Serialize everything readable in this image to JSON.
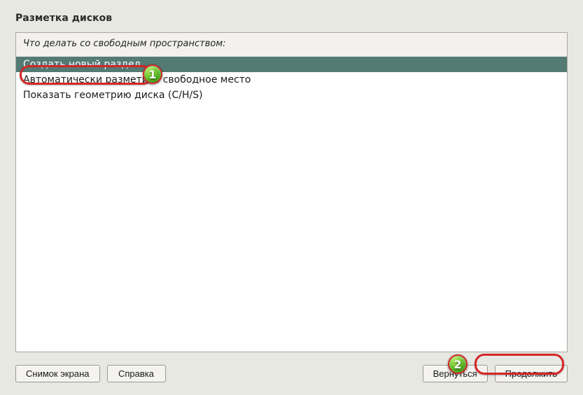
{
  "window": {
    "title": "Разметка дисков"
  },
  "prompt": "Что делать со свободным пространством:",
  "options": [
    {
      "label": "Создать новый раздел",
      "selected": true
    },
    {
      "label": "Автоматически разметить свободное место",
      "selected": false
    },
    {
      "label": "Показать геометрию диска (C/H/S)",
      "selected": false
    }
  ],
  "buttons": {
    "screenshot": "Снимок экрана",
    "help": "Справка",
    "back": "Вернуться",
    "continue": "Продолжить"
  },
  "callouts": {
    "one": "1",
    "two": "2"
  }
}
